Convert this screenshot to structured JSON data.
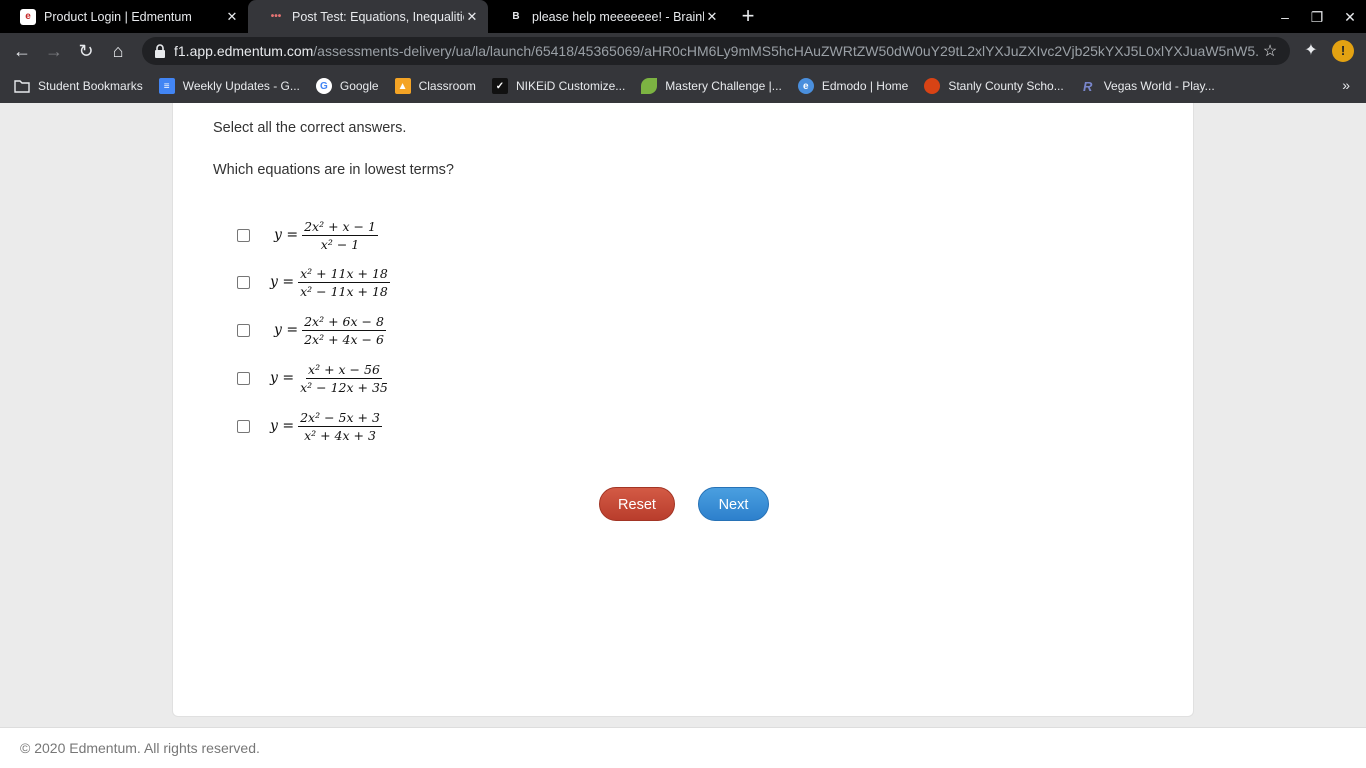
{
  "browser": {
    "tabs": [
      {
        "title": "Product Login | Edmentum",
        "favicon": "edmentum-icon"
      },
      {
        "title": "Post Test: Equations, Inequalitie",
        "favicon": "edmentum-dots-icon"
      },
      {
        "title": "please help meeeeeee! - Brainly.c",
        "favicon": "brainly-icon"
      }
    ],
    "url_host": "f1.app.edmentum.com",
    "url_path": "/assessments-delivery/ua/la/launch/65418/45365069/aHR0cHM6Ly9mMS5hcHAuZWRtZW50dW0uY29tL2xlYXJuZXIvc2Vjb25kYXJ5L0xlYXJuaW5nW5...",
    "profile_initial": "!",
    "bookmarks": [
      {
        "label": "Student Bookmarks",
        "icon": "folder-icon",
        "color": "#e8eaed"
      },
      {
        "label": "Weekly Updates - G...",
        "icon": "google-docs-icon",
        "color": "#4285f4"
      },
      {
        "label": "Google",
        "icon": "google-icon",
        "color": "#ffffff"
      },
      {
        "label": "Classroom",
        "icon": "classroom-icon",
        "color": "#f4a425"
      },
      {
        "label": "NIKEiD Customize...",
        "icon": "nike-icon",
        "color": "#111111"
      },
      {
        "label": "Mastery Challenge |...",
        "icon": "leaf-icon",
        "color": "#7cb342"
      },
      {
        "label": "Edmodo | Home",
        "icon": "edmodo-icon",
        "color": "#4a8fdd"
      },
      {
        "label": "Stanly County Scho...",
        "icon": "apple-icon",
        "color": "#d84315"
      },
      {
        "label": "Vegas World - Play...",
        "icon": "vegas-world-icon",
        "color": "#3f51b5"
      }
    ]
  },
  "assessment": {
    "instruction": "Select all the correct answers.",
    "question": "Which equations are in lowest terms?",
    "options": [
      {
        "lhs": "y =",
        "numerator": "2x² + x − 1",
        "denominator": "x² − 1",
        "checked": false
      },
      {
        "lhs": "y =",
        "numerator": "x² + 11x + 18",
        "denominator": "x² − 11x + 18",
        "checked": false
      },
      {
        "lhs": "y =",
        "numerator": "2x² + 6x − 8",
        "denominator": "2x² + 4x − 6",
        "checked": false
      },
      {
        "lhs": "y =",
        "numerator": "x² + x − 56",
        "denominator": "x² − 12x + 35",
        "checked": false
      },
      {
        "lhs": "y =",
        "numerator": "2x² − 5x + 3",
        "denominator": "x² + 4x + 3",
        "checked": false
      }
    ],
    "reset_label": "Reset",
    "next_label": "Next"
  },
  "footer": {
    "copyright": "© 2020 Edmentum. All rights reserved."
  },
  "colors": {
    "reset": "#c4483a",
    "next": "#3a8fd8"
  }
}
